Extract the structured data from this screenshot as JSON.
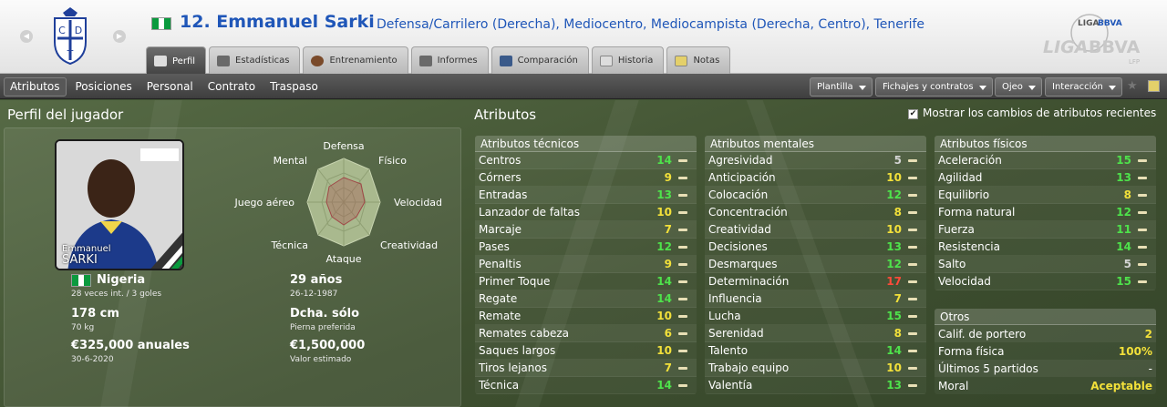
{
  "header": {
    "player_number_name": "12. Emmanuel Sarki",
    "positions_club": "Defensa/Carrilero (Derecha), Mediocentro, Mediocampista (Derecha, Centro), Tenerife",
    "flag_colors": [
      "#0a9a3e",
      "#ffffff",
      "#0a9a3e"
    ],
    "crest_letters": [
      "C",
      "D",
      "T"
    ]
  },
  "tabs": [
    {
      "label": "Perfil",
      "icon": "profile-card-icon"
    },
    {
      "label": "Estadísticas",
      "icon": "bar-chart-icon"
    },
    {
      "label": "Entrenamiento",
      "icon": "ball-icon"
    },
    {
      "label": "Informes",
      "icon": "report-icon"
    },
    {
      "label": "Comparación",
      "icon": "compare-icon"
    },
    {
      "label": "Historia",
      "icon": "history-icon"
    },
    {
      "label": "Notas",
      "icon": "notes-icon"
    }
  ],
  "subnav": {
    "items": [
      "Atributos",
      "Posiciones",
      "Personal",
      "Contrato",
      "Traspaso"
    ],
    "dropdowns": [
      "Plantilla",
      "Fichajes y contratos",
      "Ojeo",
      "Interacción"
    ]
  },
  "profile": {
    "title": "Perfil del jugador",
    "photo_first": "Emmanuel",
    "photo_last": "SARKI",
    "radar_labels": {
      "defensa": "Defensa",
      "fisico": "Físico",
      "velocidad": "Velocidad",
      "creatividad": "Creatividad",
      "ataque": "Ataque",
      "tecnica": "Técnica",
      "juego_aereo": "Juego aéreo",
      "mental": "Mental"
    },
    "nation": "Nigeria",
    "caps": "28 veces int. / 3 goles",
    "age": "29 años",
    "dob": "26-12-1987",
    "height": "178 cm",
    "weight": "70 kg",
    "foot": "Dcha. sólo",
    "foot_label": "Pierna preferida",
    "wage": "€325,000 anuales",
    "contract_end": "30-6-2020",
    "value": "€1,500,000",
    "value_label": "Valor estimado"
  },
  "attributes": {
    "title": "Atributos",
    "show_changes_label": "Mostrar los cambios de atributos recientes",
    "show_changes_checked": true,
    "technical": {
      "header": "Atributos técnicos",
      "rows": [
        {
          "name": "Centros",
          "value": "14"
        },
        {
          "name": "Córners",
          "value": "9"
        },
        {
          "name": "Entradas",
          "value": "13"
        },
        {
          "name": "Lanzador de faltas",
          "value": "10"
        },
        {
          "name": "Marcaje",
          "value": "7"
        },
        {
          "name": "Pases",
          "value": "12"
        },
        {
          "name": "Penaltis",
          "value": "9"
        },
        {
          "name": "Primer Toque",
          "value": "14"
        },
        {
          "name": "Regate",
          "value": "14"
        },
        {
          "name": "Remate",
          "value": "10"
        },
        {
          "name": "Remates cabeza",
          "value": "6"
        },
        {
          "name": "Saques largos",
          "value": "10"
        },
        {
          "name": "Tiros lejanos",
          "value": "7"
        },
        {
          "name": "Técnica",
          "value": "14"
        }
      ]
    },
    "mental": {
      "header": "Atributos mentales",
      "rows": [
        {
          "name": "Agresividad",
          "value": "5"
        },
        {
          "name": "Anticipación",
          "value": "10"
        },
        {
          "name": "Colocación",
          "value": "12"
        },
        {
          "name": "Concentración",
          "value": "8"
        },
        {
          "name": "Creatividad",
          "value": "10"
        },
        {
          "name": "Decisiones",
          "value": "13"
        },
        {
          "name": "Desmarques",
          "value": "12"
        },
        {
          "name": "Determinación",
          "value": "17"
        },
        {
          "name": "Influencia",
          "value": "7"
        },
        {
          "name": "Lucha",
          "value": "15"
        },
        {
          "name": "Serenidad",
          "value": "8"
        },
        {
          "name": "Talento",
          "value": "14"
        },
        {
          "name": "Trabajo equipo",
          "value": "10"
        },
        {
          "name": "Valentía",
          "value": "13"
        }
      ]
    },
    "physical": {
      "header": "Atributos físicos",
      "rows": [
        {
          "name": "Aceleración",
          "value": "15"
        },
        {
          "name": "Agilidad",
          "value": "13"
        },
        {
          "name": "Equilibrio",
          "value": "8"
        },
        {
          "name": "Forma natural",
          "value": "12"
        },
        {
          "name": "Fuerza",
          "value": "11"
        },
        {
          "name": "Resistencia",
          "value": "14"
        },
        {
          "name": "Salto",
          "value": "5"
        },
        {
          "name": "Velocidad",
          "value": "15"
        }
      ]
    },
    "others": {
      "header": "Otros",
      "rows": [
        {
          "name": "Calif. de portero",
          "value": "2"
        },
        {
          "name": "Forma física",
          "value": "100%"
        },
        {
          "name": "Últimos 5 partidos",
          "value": "-"
        },
        {
          "name": "Moral",
          "value": "Aceptable"
        }
      ]
    }
  }
}
